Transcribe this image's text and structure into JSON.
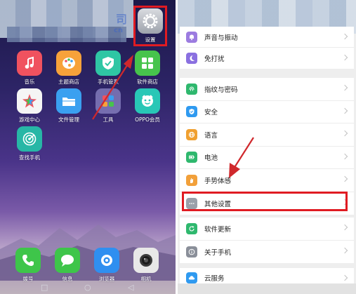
{
  "home_screen": {
    "settings_app": {
      "label": "设置",
      "icon": "gear-icon",
      "color": "#a9adb5"
    },
    "watermark": {
      "line1": "司",
      "line2": "cn"
    },
    "apps": [
      {
        "id": "music",
        "label": "音乐",
        "icon": "music-note-icon",
        "color": "#f0525f"
      },
      {
        "id": "theme-store",
        "label": "主题商店",
        "icon": "palette-icon",
        "color": "#f7a23a"
      },
      {
        "id": "phone-manager",
        "label": "手机管家",
        "icon": "shield-icon",
        "color": "#2fc6a4"
      },
      {
        "id": "software-store",
        "label": "软件商店",
        "icon": "grid-icon",
        "color": "#47c44c"
      },
      {
        "id": "game-center",
        "label": "游戏中心",
        "icon": "star-icon",
        "color": "#f5f5f5"
      },
      {
        "id": "file-manager",
        "label": "文件管理",
        "icon": "folder-icon",
        "color": "#3aa0f0"
      },
      {
        "id": "tools",
        "label": "工具",
        "icon": "folder-grid-icon",
        "color": "#8c86c6"
      },
      {
        "id": "oppo-member",
        "label": "OPPO会员",
        "icon": "face-icon",
        "color": "#28c7b6"
      },
      {
        "id": "find-phone",
        "label": "查找手机",
        "icon": "radar-icon",
        "color": "#27b7a6"
      }
    ],
    "dock": [
      {
        "id": "dialer",
        "label": "拨号",
        "icon": "phone-icon",
        "color": "#3ec54a"
      },
      {
        "id": "messages",
        "label": "信息",
        "icon": "chat-bubble-icon",
        "color": "#3ec54a"
      },
      {
        "id": "browser",
        "label": "浏览器",
        "icon": "globe-icon",
        "color": "#2f8ff0"
      },
      {
        "id": "camera",
        "label": "相机",
        "icon": "camera-lens-icon",
        "color": "#e8e8e8"
      }
    ]
  },
  "settings_screen": {
    "groups": [
      {
        "items": [
          {
            "id": "sound",
            "label": "声音与振动",
            "icon": "bell-icon",
            "color": "#9c7ce0"
          },
          {
            "id": "dnd",
            "label": "免打扰",
            "icon": "moon-icon",
            "color": "#8a70e0"
          }
        ]
      },
      {
        "items": [
          {
            "id": "fingerprint",
            "label": "指纹与密码",
            "icon": "fingerprint-icon",
            "color": "#2fb86e"
          },
          {
            "id": "security",
            "label": "安全",
            "icon": "shield-icon",
            "color": "#2f9af0"
          },
          {
            "id": "language",
            "label": "语言",
            "icon": "globe-icon",
            "color": "#f0a030"
          },
          {
            "id": "battery",
            "label": "电池",
            "icon": "battery-icon",
            "color": "#2fb86e"
          },
          {
            "id": "gesture",
            "label": "手势体感",
            "icon": "hand-icon",
            "color": "#f2a03a"
          },
          {
            "id": "other",
            "label": "其他设置",
            "icon": "more-dots-icon",
            "color": "#9aa0aa"
          }
        ]
      },
      {
        "items": [
          {
            "id": "update",
            "label": "软件更新",
            "icon": "refresh-icon",
            "color": "#2fb86e"
          },
          {
            "id": "about",
            "label": "关于手机",
            "icon": "info-icon",
            "color": "#8a8f99"
          }
        ]
      },
      {
        "items": [
          {
            "id": "cloud",
            "label": "云服务",
            "icon": "cloud-icon",
            "color": "#2f9af0"
          }
        ]
      }
    ]
  },
  "annotations": {
    "highlight_color": "#e01b22",
    "arrow_color": "#d0282c"
  }
}
